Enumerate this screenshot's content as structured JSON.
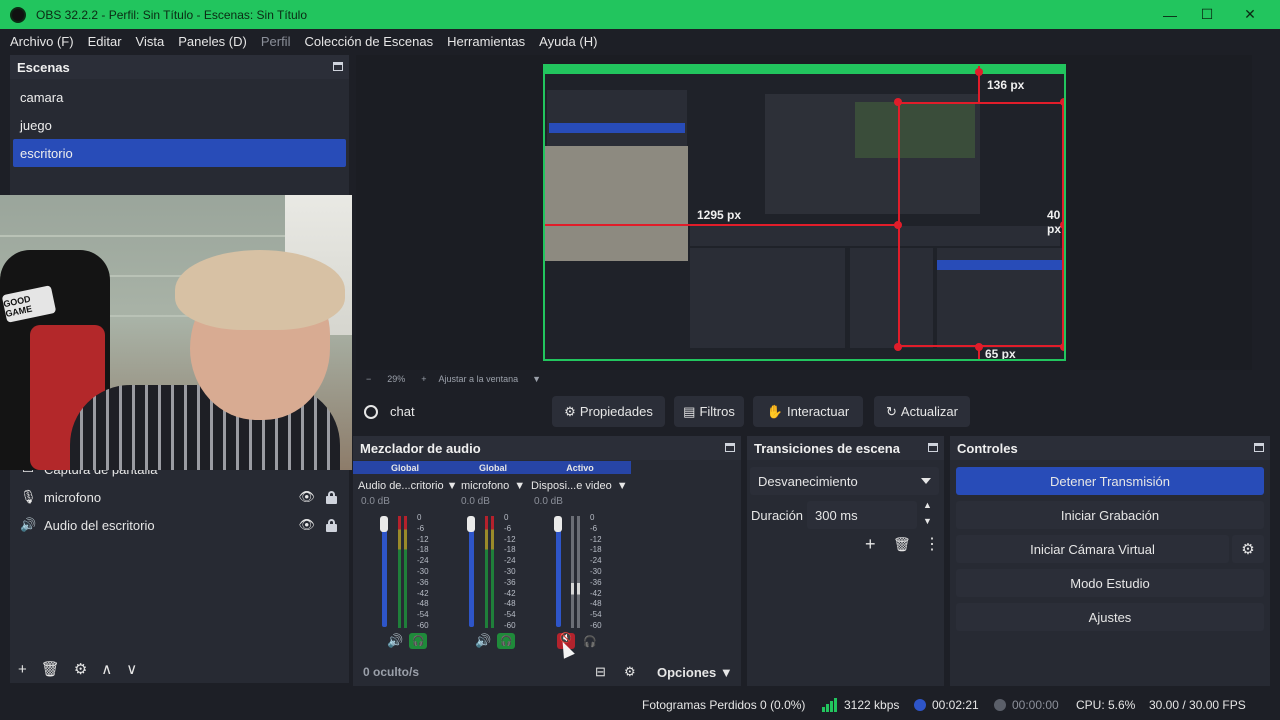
{
  "window": {
    "title": "OBS 32.2.2 - Perfil: Sin Título - Escenas: Sin Título",
    "minimize": "—",
    "maximize": "☐",
    "close": "✕"
  },
  "menu": [
    "Archivo (F)",
    "Editar",
    "Vista",
    "Paneles (D)",
    "Perfil",
    "Colección de Escenas",
    "Herramientas",
    "Ayuda (H)"
  ],
  "scenes": {
    "title": "Escenas",
    "items": [
      {
        "label": "camara",
        "active": false
      },
      {
        "label": "juego",
        "active": false
      },
      {
        "label": "escritorio",
        "active": true
      }
    ]
  },
  "webcam": {
    "chair_badge": "GOOD GAME"
  },
  "sources": {
    "items": [
      {
        "label": "Captura de pantalla",
        "icon": "monitor-icon"
      },
      {
        "label": "microfono",
        "icon": "microphone-icon"
      },
      {
        "label": "Audio del escritorio",
        "icon": "speaker-icon"
      }
    ],
    "toolbar": [
      "+",
      "🗑",
      "⚙",
      "∧",
      "∨"
    ]
  },
  "preview": {
    "labels": {
      "top": "136 px",
      "left": "1295 px",
      "right": "40 px",
      "bottom": "65 px"
    },
    "zoom": {
      "minus": "−",
      "value": "29%",
      "plus": "+",
      "fit": "Ajustar a la ventana"
    },
    "colors": {
      "border": "#22c55e",
      "guides": "#e11d2a"
    }
  },
  "source_toolbar": {
    "selected": "chat",
    "buttons": [
      {
        "label": "Propiedades",
        "icon": "gear-icon"
      },
      {
        "label": "Filtros",
        "icon": "filter-icon"
      },
      {
        "label": "Interactuar",
        "icon": "hand-icon"
      },
      {
        "label": "Actualizar",
        "icon": "refresh-icon"
      }
    ]
  },
  "mixer": {
    "title": "Mezclador de audio",
    "scale": [
      "0",
      "-6",
      "-12",
      "-18",
      "-24",
      "-30",
      "-36",
      "-42",
      "-48",
      "-54",
      "-60"
    ],
    "channels": [
      {
        "tag": "Global",
        "name": "Audio de...critorio",
        "db": "0.0 dB",
        "muted": false
      },
      {
        "tag": "Global",
        "name": "microfono",
        "db": "0.0 dB",
        "muted": false
      },
      {
        "tag": "Activo",
        "name": "Disposi...e video",
        "db": "0.0 dB",
        "muted": true
      }
    ],
    "hidden": "0 oculto/s",
    "options": "Opciones"
  },
  "transitions": {
    "title": "Transiciones de escena",
    "type": "Desvanecimiento",
    "duration_label": "Duración",
    "duration": "300 ms"
  },
  "controls": {
    "title": "Controles",
    "buttons": [
      "Detener Transmisión",
      "Iniciar Grabación",
      "Iniciar Cámara Virtual",
      "Modo Estudio",
      "Ajustes"
    ]
  },
  "status": {
    "dropped": "Fotogramas Perdidos 0 (0.0%)",
    "bitrate": "3122 kbps",
    "live_time": "00:02:21",
    "rec_time": "00:00:00",
    "cpu": "CPU: 5.6%",
    "fps": "30.00 / 30.00 FPS"
  }
}
